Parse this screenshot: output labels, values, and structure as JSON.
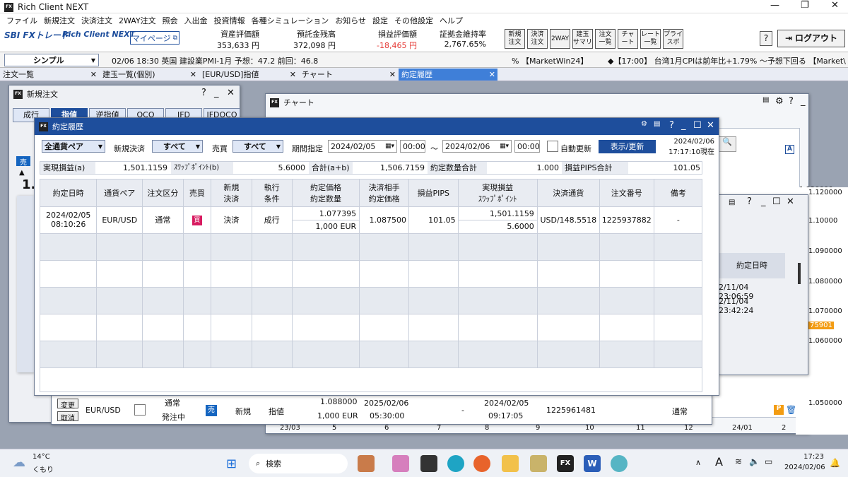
{
  "app": {
    "title": "Rich Client NEXT",
    "logo": "FX"
  },
  "menu": [
    "ファイル",
    "新規注文",
    "決済注文",
    "2WAY注文",
    "照会",
    "入出金",
    "投資情報",
    "各種シミュレーション",
    "お知らせ",
    "設定",
    "その他設定",
    "ヘルプ"
  ],
  "header": {
    "brand_a": "SBI FXトレード",
    "brand_b": "Rich Client NEXT",
    "mypage": "マイページ",
    "asset_label": "資産評価額",
    "asset_value": "353,633 円",
    "margin_label": "預託金残高",
    "margin_value": "372,098 円",
    "pnl_label": "損益評価額",
    "pnl_value": "-18,465 円",
    "ratio_label": "証拠金維持率",
    "ratio_value": "2,767.65%",
    "buttons": [
      "新規\n注文",
      "決済\n注文",
      "2WAY",
      "建玉\nサマリ",
      "注文\n一覧",
      "チャ\nート",
      "レート\n一覧",
      "プライ\nスボ"
    ],
    "help": "?",
    "logout": "ログアウト"
  },
  "ticker": {
    "mode": "シンプル",
    "news": "02/06 18:30 英国 建設業PMI-1月 予想：47.2 前回：46.8",
    "market": "% 【MarketWin24】",
    "news2": "◆【17:00】 台湾1月CPIは前年比+1.79% ～予想下回る 【Market\\"
  },
  "tabs": [
    "注文一覧",
    "建玉一覧(個別)",
    "[EUR/USD]指値",
    "チャート",
    "約定履歴"
  ],
  "new_order": {
    "title": "新規注文",
    "tabs": [
      "成行",
      "指値",
      "逆指値",
      "OCO",
      "IFD",
      "IFDOCO"
    ],
    "sell": "売",
    "rate_partial": "1."
  },
  "chart": {
    "title": "チャート",
    "axis_y": [
      "1.120000",
      "1.10000",
      "1.090000",
      "1.080000",
      "1.070000",
      "1.060000",
      "1.050000"
    ],
    "price_tag": "75901",
    "axis_x": [
      "23/03",
      "5",
      "6",
      "7",
      "8",
      "9",
      "10",
      "11",
      "12",
      "24/01",
      "2"
    ],
    "a_mark": "A",
    "p_mark": "P"
  },
  "side_panel": {
    "header": "約定日時",
    "rows": [
      "2/11/04 23:06:59",
      "2/11/04 23:42:24"
    ]
  },
  "history": {
    "title": "約定履歴",
    "filter": {
      "pair": "全通貨ペア",
      "newclose_label": "新規決済",
      "newclose": "すべて",
      "side_label": "売買",
      "side": "すべて",
      "period_label": "期間指定",
      "from_date": "2024/02/05",
      "from_time": "00:00",
      "tilde": "～",
      "to_date": "2024/02/06",
      "to_time": "00:00",
      "auto": "自動更新",
      "show": "表示/更新",
      "as_of_date": "2024/02/06",
      "as_of_time": "17:17:10現在"
    },
    "summary": {
      "realized_label": "実現損益(a)",
      "realized": "1,501.1159",
      "swap_label": "ｽﾜｯﾌﾟﾎﾟｲﾝﾄ(b)",
      "swap": "5.6000",
      "total_label": "合計(a+b)",
      "total": "1,506.7159",
      "qty_label": "約定数量合計",
      "qty": "1.000",
      "pips_label": "損益PIPS合計",
      "pips": "101.05"
    },
    "columns": [
      "約定日時",
      "通貨ペア",
      "注文区分",
      "売買",
      "新規\n決済",
      "執行\n条件",
      "約定価格\n約定数量",
      "決済相手\n約定価格",
      "損益PIPS",
      "実現損益\nｽﾜｯﾌﾟﾎﾟｲﾝﾄ",
      "決済通貨",
      "注文番号",
      "備考"
    ],
    "row": {
      "date": "2024/02/05",
      "time": "08:10:26",
      "pair": "EUR/USD",
      "kind": "通常",
      "side": "買",
      "newclose": "決済",
      "exec": "成行",
      "price": "1.077395",
      "qty": "1,000 EUR",
      "counter": "1.087500",
      "pips": "101.05",
      "pnl": "1,501.1159",
      "swap": "5.6000",
      "ccy": "USD/148.5518",
      "order": "1225937882",
      "note": "-"
    }
  },
  "order_row": {
    "change": "変更",
    "cancel": "取消",
    "pair": "EUR/USD",
    "kind": "通常",
    "status": "発注中",
    "side": "売",
    "newclose": "新規",
    "exec": "指値",
    "price": "1.088000",
    "qty": "1,000 EUR",
    "expire": "2025/02/06",
    "expire_time": "05:30:00",
    "date": "2024/02/05",
    "time": "09:17:05",
    "order": "1225961481",
    "note": "通常",
    "dash": "-"
  },
  "taskbar": {
    "temp": "14°C",
    "weather": "くもり",
    "search": "検索",
    "time": "17:23",
    "date": "2024/02/06"
  },
  "colors": {
    "accent": "#1e4e9c",
    "sell": "#1565c0",
    "buy": "#d81b60",
    "negative": "#e53935"
  }
}
